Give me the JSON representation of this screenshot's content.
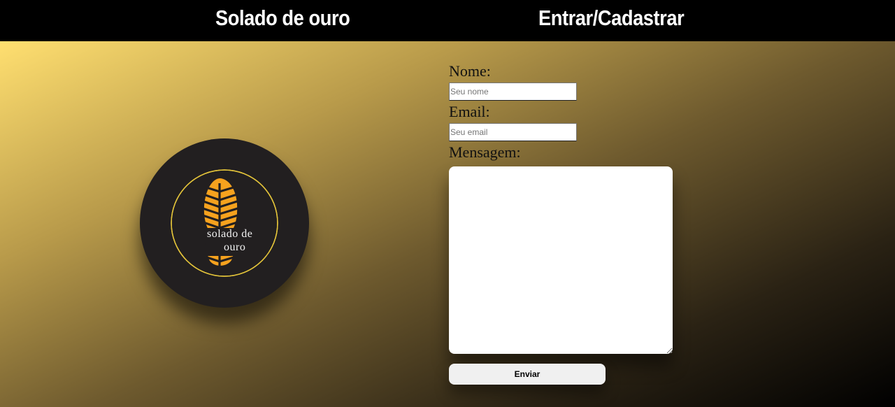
{
  "header": {
    "brand": "Solado de ouro",
    "login_link": "Entrar/Cadastrar",
    "background": "#000000"
  },
  "logo": {
    "line1": "solado de",
    "line2": "ouro",
    "icon": "boot-sole-icon",
    "accent": "#f6a21e",
    "ring_color": "#e4c43a",
    "background": "#221f20"
  },
  "form": {
    "name_label": "Nome:",
    "name_placeholder": "Seu nome",
    "name_value": "",
    "email_label": "Email:",
    "email_placeholder": "Seu email",
    "email_value": "",
    "message_label": "Mensagem:",
    "message_value": "",
    "submit_label": "Enviar"
  },
  "colors": {
    "gradient_start": "#ffdf70",
    "gradient_end": "#000000"
  }
}
